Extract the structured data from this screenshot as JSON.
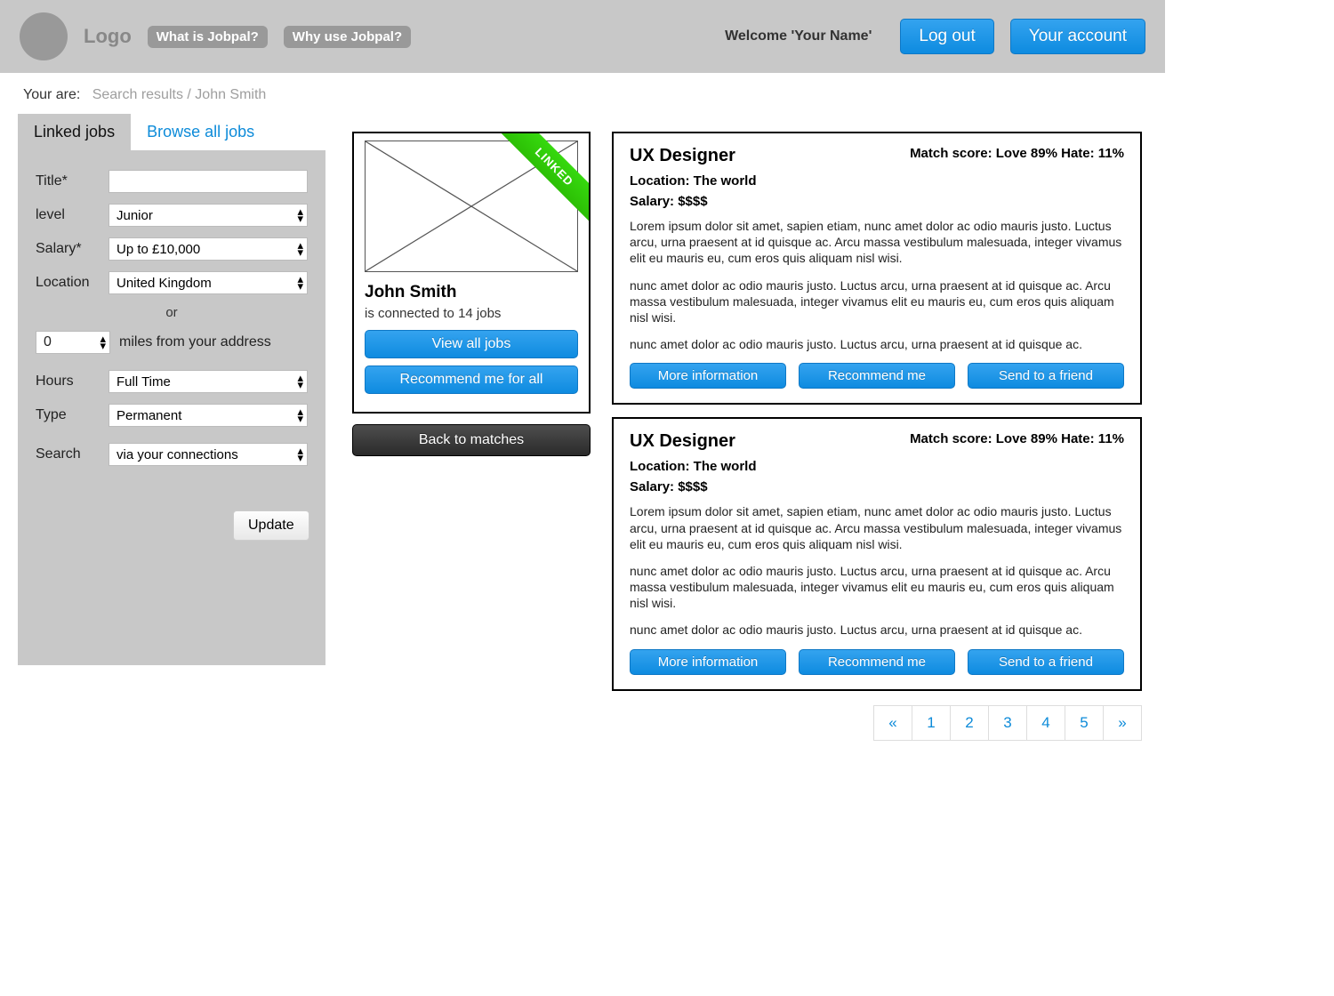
{
  "header": {
    "logo_text": "Logo",
    "nav": [
      "What is Jobpal?",
      "Why use Jobpal?"
    ],
    "welcome": "Welcome 'Your Name'",
    "logout": "Log out",
    "account": "Your account"
  },
  "breadcrumb": {
    "prefix": "Your are:",
    "path": "Search results / John Smith"
  },
  "tabs": {
    "linked": "Linked jobs",
    "browse": "Browse all jobs"
  },
  "filters": {
    "title_label": "Title*",
    "title_value": "",
    "level_label": "level",
    "level_value": "Junior",
    "salary_label": "Salary*",
    "salary_value": "Up to £10,000",
    "location_label": "Location",
    "location_value": "United Kingdom",
    "or": "or",
    "miles_value": "0",
    "miles_suffix": "miles from your address",
    "hours_label": "Hours",
    "hours_value": "Full Time",
    "type_label": "Type",
    "type_value": "Permanent",
    "search_label": "Search",
    "search_value": "via your connections",
    "update": "Update"
  },
  "profile": {
    "ribbon": "LINKED",
    "name": "John Smith",
    "sub": "is connected to 14 jobs",
    "view_all": "View all jobs",
    "recommend_all": "Recommend me for all",
    "back": "Back to matches"
  },
  "jobs": [
    {
      "title": "UX Designer",
      "match": "Match score: Love 89% Hate: 11%",
      "location": "Location: The world",
      "salary": "Salary: $$$$",
      "p1": "Lorem ipsum dolor sit amet, sapien etiam, nunc amet dolor ac odio mauris justo. Luctus arcu, urna praesent at id quisque ac. Arcu massa vestibulum malesuada, integer vivamus elit eu mauris eu, cum eros quis aliquam nisl wisi.",
      "p2": "nunc amet dolor ac odio mauris justo. Luctus arcu, urna praesent at id quisque ac. Arcu massa vestibulum malesuada, integer vivamus elit eu mauris eu, cum eros quis aliquam nisl wisi.",
      "p3": "nunc amet dolor ac odio mauris justo. Luctus arcu, urna praesent at id quisque ac.",
      "more": "More information",
      "recommend": "Recommend me",
      "send": "Send to a friend"
    },
    {
      "title": "UX Designer",
      "match": "Match score: Love 89% Hate: 11%",
      "location": "Location: The world",
      "salary": "Salary: $$$$",
      "p1": "Lorem ipsum dolor sit amet, sapien etiam, nunc amet dolor ac odio mauris justo. Luctus arcu, urna praesent at id quisque ac. Arcu massa vestibulum malesuada, integer vivamus elit eu mauris eu, cum eros quis aliquam nisl wisi.",
      "p2": "nunc amet dolor ac odio mauris justo. Luctus arcu, urna praesent at id quisque ac. Arcu massa vestibulum malesuada, integer vivamus elit eu mauris eu, cum eros quis aliquam nisl wisi.",
      "p3": "nunc amet dolor ac odio mauris justo. Luctus arcu, urna praesent at id quisque ac.",
      "more": "More information",
      "recommend": "Recommend me",
      "send": "Send to a friend"
    }
  ],
  "pagination": {
    "prev": "«",
    "pages": [
      "1",
      "2",
      "3",
      "4",
      "5"
    ],
    "next": "»"
  }
}
